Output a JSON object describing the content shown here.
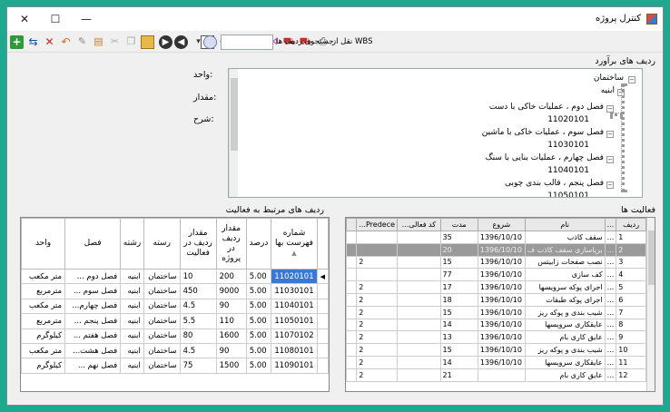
{
  "window": {
    "title": "کنترل پروژه",
    "minimize": "—",
    "maximize": "☐",
    "close": "✕"
  },
  "toolbar": {
    "transfer_wbs_label": "نقل از WBS",
    "search_rows_label": "جستجوی ردیف ها",
    "search_value": ""
  },
  "tree_panel": {
    "label": "ردیف های برآورد",
    "nodes": [
      {
        "text": "ساختمان",
        "level": 0
      },
      {
        "text": "ابنیه",
        "level": 1
      },
      {
        "text": "فصل دوم ، عملیات خاکی با دست",
        "level": 2
      },
      {
        "text": "11020101",
        "level": 3
      },
      {
        "text": "فصل سوم ، عملیات خاکی با ماشین",
        "level": 2
      },
      {
        "text": "11030101",
        "level": 3
      },
      {
        "text": "فصل چهارم ، عملیات بنایی با سنگ",
        "level": 2
      },
      {
        "text": "11040101",
        "level": 3
      },
      {
        "text": "فصل پنجم ، قالب بندی چوبی",
        "level": 2
      },
      {
        "text": "11050101",
        "level": 3
      }
    ]
  },
  "fields": {
    "unit_label": "واحد:",
    "quantity_label": "مقدار:",
    "description_label": "شرح:"
  },
  "related_rows": {
    "label": "ردیف های مرتبط به فعالیت",
    "columns": [
      "شماره فهرست بها",
      "درصد",
      "مقدار ردیف در پروژه",
      "مقدار ردیف در فعالیت",
      "رسته",
      "رشته",
      "فصل",
      "واحد"
    ],
    "rows": [
      {
        "code": "11020101",
        "percent": "5.00",
        "project_qty": "200",
        "activity_qty": "10",
        "category": "ساختمان",
        "discipline": "ابنیه",
        "chapter": "فصل دوم ...",
        "unit": "متر مکعب"
      },
      {
        "code": "11030101",
        "percent": "5.00",
        "project_qty": "9000",
        "activity_qty": "450",
        "category": "ساختمان",
        "discipline": "ابنیه",
        "chapter": "فصل سوم ...",
        "unit": "مترمربع"
      },
      {
        "code": "11040101",
        "percent": "5.00",
        "project_qty": "90",
        "activity_qty": "4.5",
        "category": "ساختمان",
        "discipline": "ابنیه",
        "chapter": "فصل چهارم...",
        "unit": "متر مکعب"
      },
      {
        "code": "11050101",
        "percent": "5.00",
        "project_qty": "110",
        "activity_qty": "5.5",
        "category": "ساختمان",
        "discipline": "ابنیه",
        "chapter": "فصل پنجم ...",
        "unit": "مترمربع"
      },
      {
        "code": "11070102",
        "percent": "5.00",
        "project_qty": "1600",
        "activity_qty": "80",
        "category": "ساختمان",
        "discipline": "ابنیه",
        "chapter": "فصل هفتم ...",
        "unit": "کیلوگرم"
      },
      {
        "code": "11080101",
        "percent": "5.00",
        "project_qty": "90",
        "activity_qty": "4.5",
        "category": "ساختمان",
        "discipline": "ابنیه",
        "chapter": "فصل هشت...",
        "unit": "متر مکعب"
      },
      {
        "code": "11090101",
        "percent": "5.00",
        "project_qty": "1500",
        "activity_qty": "75",
        "category": "ساختمان",
        "discipline": "ابنیه",
        "chapter": "فصل نهم ...",
        "unit": "کیلوگرم"
      }
    ]
  },
  "activities": {
    "label": "فعالیت ها",
    "columns": [
      "ردیف",
      "...",
      "نام",
      "شروع",
      "مدت",
      "کد فعالی...",
      "Predece..."
    ],
    "rows": [
      {
        "id": "1",
        "dots": "...",
        "name": "سقف کاذب",
        "start": "1396/10/10",
        "duration": "35",
        "code": "",
        "pred": ""
      },
      {
        "id": "2",
        "dots": "...",
        "name": "برپاسازی سقف کاذب ف",
        "start": "1396/10/10",
        "duration": "20",
        "code": "",
        "pred": ""
      },
      {
        "id": "3",
        "dots": "...",
        "name": "نصب صفحات زابیتس",
        "start": "1396/10/10",
        "duration": "15",
        "code": "",
        "pred": "2"
      },
      {
        "id": "4",
        "dots": "...",
        "name": "کف سازی",
        "start": "1396/10/10",
        "duration": "77",
        "code": "",
        "pred": ""
      },
      {
        "id": "5",
        "dots": "...",
        "name": "اجرای پوکه سرویسها",
        "start": "1396/10/10",
        "duration": "17",
        "code": "",
        "pred": "2"
      },
      {
        "id": "6",
        "dots": "...",
        "name": "اجرای پوکه طبقات",
        "start": "1396/10/10",
        "duration": "18",
        "code": "",
        "pred": "2"
      },
      {
        "id": "7",
        "dots": "...",
        "name": "شیب بندی و پوکه ریز",
        "start": "1396/10/10",
        "duration": "15",
        "code": "",
        "pred": "2"
      },
      {
        "id": "8",
        "dots": "...",
        "name": "عایقکاری سرویسها",
        "start": "1396/10/10",
        "duration": "14",
        "code": "",
        "pred": "2"
      },
      {
        "id": "9",
        "dots": "...",
        "name": "عایق کاری بام",
        "start": "1396/10/10",
        "duration": "13",
        "code": "",
        "pred": "2"
      },
      {
        "id": "10",
        "dots": "...",
        "name": "شیب بندی و پوکه ریز",
        "start": "1396/10/10",
        "duration": "15",
        "code": "",
        "pred": "2"
      },
      {
        "id": "11",
        "dots": "...",
        "name": "عایقکاری سرویسها",
        "start": "1396/10/10",
        "duration": "14",
        "code": "",
        "pred": "2"
      },
      {
        "id": "12",
        "dots": "...",
        "name": "عایق کاری بام",
        "start": "",
        "duration": "21",
        "code": "",
        "pred": "2"
      }
    ]
  }
}
